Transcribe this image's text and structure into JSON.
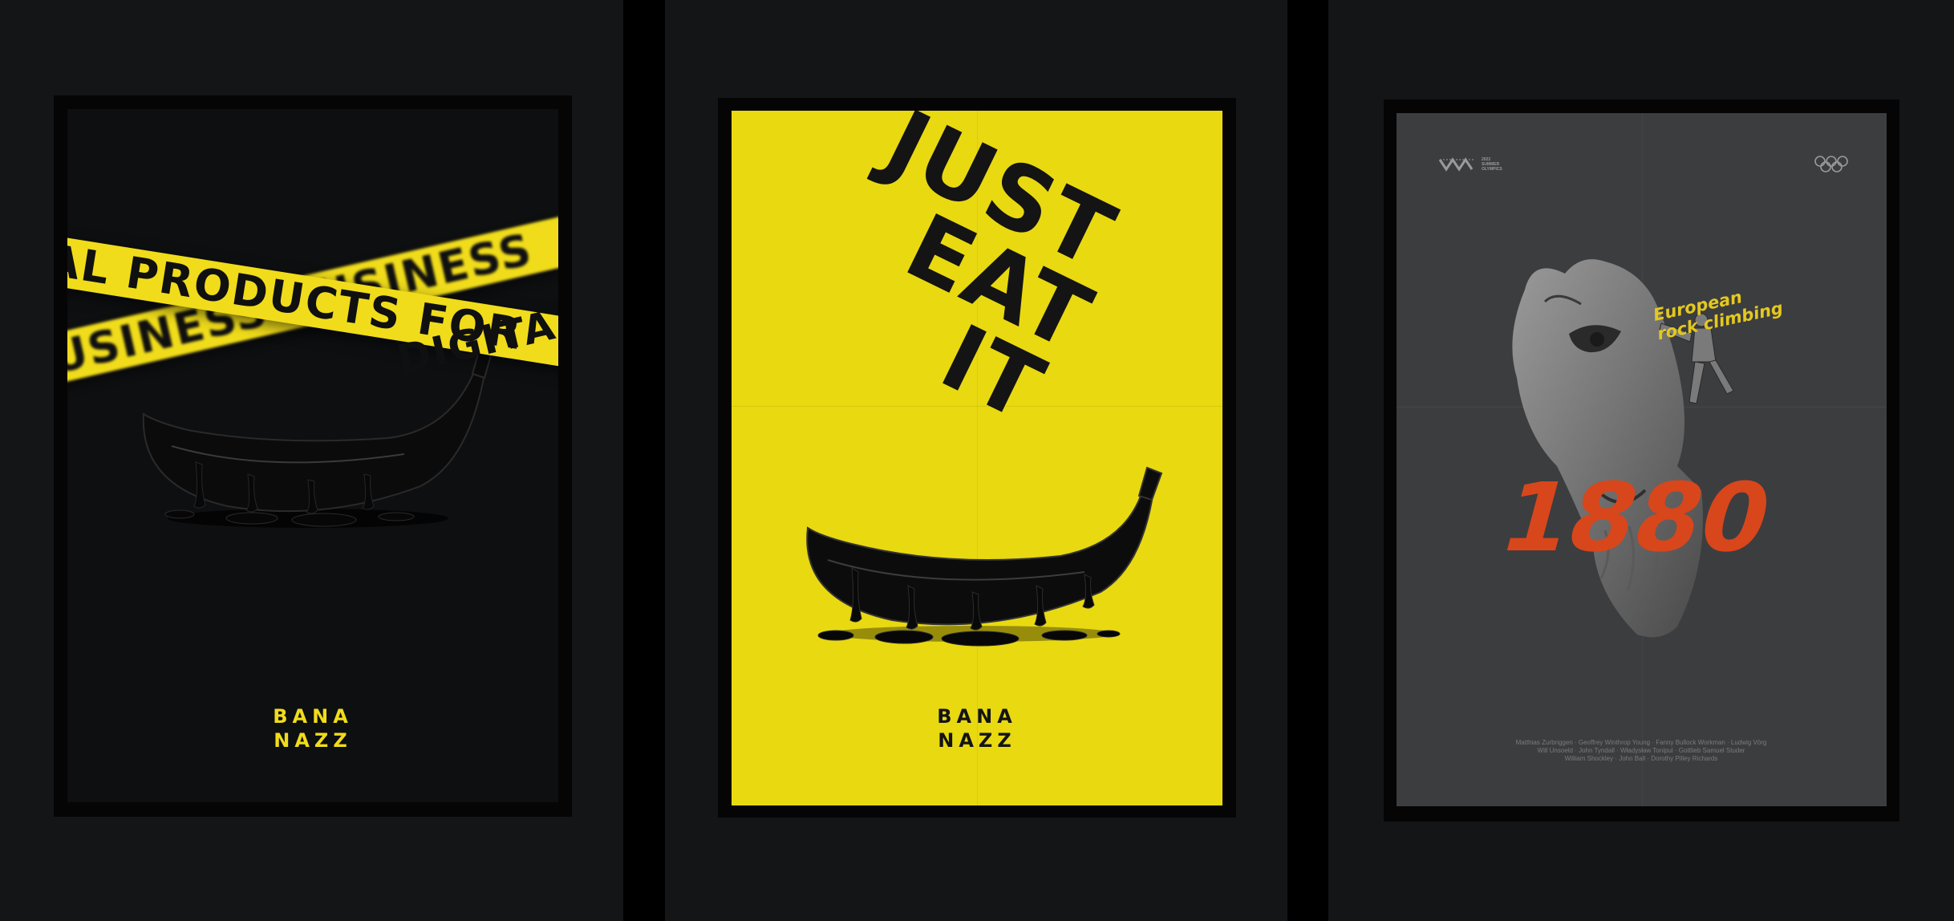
{
  "posters": [
    {
      "id": "caution-tape",
      "tape_back_text": "BUSINESS BUSINESS",
      "tape_front_text": "AL PRODUCTS FOR",
      "tape_corner_text": "DIGITA",
      "logo_line1": "BANA",
      "logo_line2": "NAZZ",
      "colors": {
        "background": "#0e0f11",
        "tape": "#f0dc1a",
        "logo": "#f0dc1a"
      }
    },
    {
      "id": "just-eat-it",
      "headline_line1": "JUST",
      "headline_line2": "EAT",
      "headline_line3": "IT",
      "logo_line1": "BANA",
      "logo_line2": "NAZZ",
      "colors": {
        "background": "#e9d911",
        "ink": "#141414"
      }
    },
    {
      "id": "rock-climbing",
      "subtitle_line1": "European",
      "subtitle_line2": "rock climbing",
      "year": "1880",
      "badge_text_line1": "2022",
      "badge_text_line2": "SUMMER",
      "badge_text_line3": "OLYMPICS",
      "credits_line1": "Matthias Zurbriggen · Geoffrey Winthrop Young · Fanny Bullock Workman · Ludwig Vörg",
      "credits_line2": "Will Unsoeld · John Tyndall · Władysław Tonipul · Gottlieb Samuel Studer",
      "credits_line3": "William Shockley · John Ball · Dorothy Pilley Richards",
      "colors": {
        "background": "#3c3d3f",
        "subtitle": "#e4c81e",
        "year": "#d8461c",
        "stone": "#8e8e8e"
      },
      "icons": [
        "summit-logo-icon",
        "olympic-rings-icon"
      ]
    }
  ]
}
